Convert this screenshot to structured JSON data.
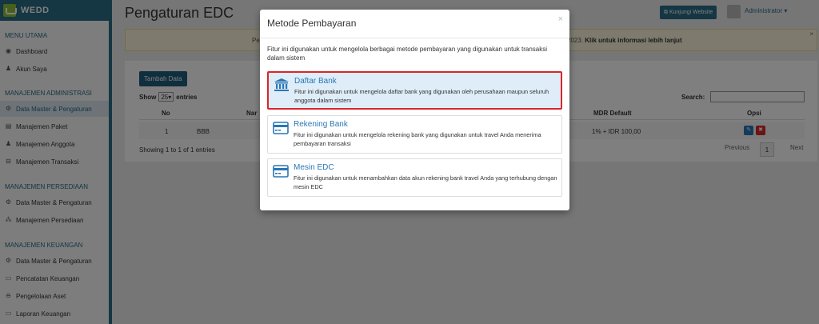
{
  "app": {
    "brand": "WEDD"
  },
  "sidebar": {
    "sections": [
      {
        "title": "MENU UTAMA",
        "items": [
          {
            "label": "Dashboard",
            "icon": "dashboard-icon",
            "glyph": "◉"
          },
          {
            "label": "Akun Saya",
            "icon": "user-icon",
            "glyph": "♟"
          }
        ]
      },
      {
        "title": "MANAJEMEN ADMINISTRASI",
        "items": [
          {
            "label": "Data Master & Pengaturan",
            "icon": "cogs-icon",
            "glyph": "⚙",
            "active": true
          },
          {
            "label": "Manajemen Paket",
            "icon": "book-icon",
            "glyph": "▤"
          },
          {
            "label": "Manajemen Anggota",
            "icon": "users-icon",
            "glyph": "♟"
          },
          {
            "label": "Manajemen Transaksi",
            "icon": "cart-icon",
            "glyph": "⊟"
          }
        ]
      },
      {
        "title": "MANAJEMEN PERSEDIAAN",
        "items": [
          {
            "label": "Data Master & Pengaturan",
            "icon": "cogs-icon",
            "glyph": "⚙"
          },
          {
            "label": "Manajemen Persediaan",
            "icon": "cubes-icon",
            "glyph": "⁂"
          }
        ]
      },
      {
        "title": "MANAJEMEN KEUANGAN",
        "items": [
          {
            "label": "Data Master & Pengaturan",
            "icon": "cogs-icon",
            "glyph": "⚙"
          },
          {
            "label": "Pencatatan Keuangan",
            "icon": "money-icon",
            "glyph": "▭"
          },
          {
            "label": "Pengelolaan Aset",
            "icon": "hdd-icon",
            "glyph": "⊖"
          },
          {
            "label": "Laporan Keuangan",
            "icon": "report-icon",
            "glyph": "▭"
          }
        ]
      }
    ]
  },
  "header": {
    "page_title": "Pengaturan EDC",
    "visit_button": "Kunjungi Website",
    "user_name": "Administrator ▾"
  },
  "alert": {
    "left_text": "Pe",
    "right_text": "2023.",
    "right_link": "Klik untuk informasi lebih lanjut",
    "close": "×"
  },
  "panel": {
    "add_button": "Tambah Data",
    "show_label": "Show",
    "show_value": "25",
    "entries_label": "entries",
    "search_label": "Search:",
    "columns": [
      "No",
      "Nar",
      "MDR Default",
      "Opsi"
    ],
    "rows": [
      {
        "no": "1",
        "name": "BBB",
        "mdr": "1% + IDR 100,00"
      }
    ],
    "info": "Showing 1 to 1 of 1 entries",
    "pager": {
      "prev": "Previous",
      "page": "1",
      "next": "Next"
    }
  },
  "modal": {
    "title": "Metode Pembayaran",
    "close": "×",
    "description": "Fitur ini digunakan untuk mengelola berbagai metode pembayaran yang digunakan untuk transaksi dalam sistem",
    "options": [
      {
        "title": "Daftar Bank",
        "icon": "bank-icon",
        "description": "Fitur ini digunakan untuk mengelola daftar bank yang digunakan oleh perusahaan maupun seluruh anggota dalam sistem",
        "highlighted": true
      },
      {
        "title": "Rekening Bank",
        "icon": "credit-card-icon",
        "description": "Fitur ini digunakan untuk mengelola rekening bank yang digunakan untuk travel Anda menerima pembayaran transaksi"
      },
      {
        "title": "Mesin EDC",
        "icon": "credit-card-icon",
        "description": "Fitur ini digunakan untuk menambahkan data akun rekening bank travel Anda yang terhubung dengan mesin EDC"
      }
    ]
  },
  "colors": {
    "primary": "#2a6c86",
    "accent": "#2a77b5",
    "highlight_border": "#d9262b",
    "highlight_bg": "#dfedf8",
    "danger": "#d9262b"
  }
}
